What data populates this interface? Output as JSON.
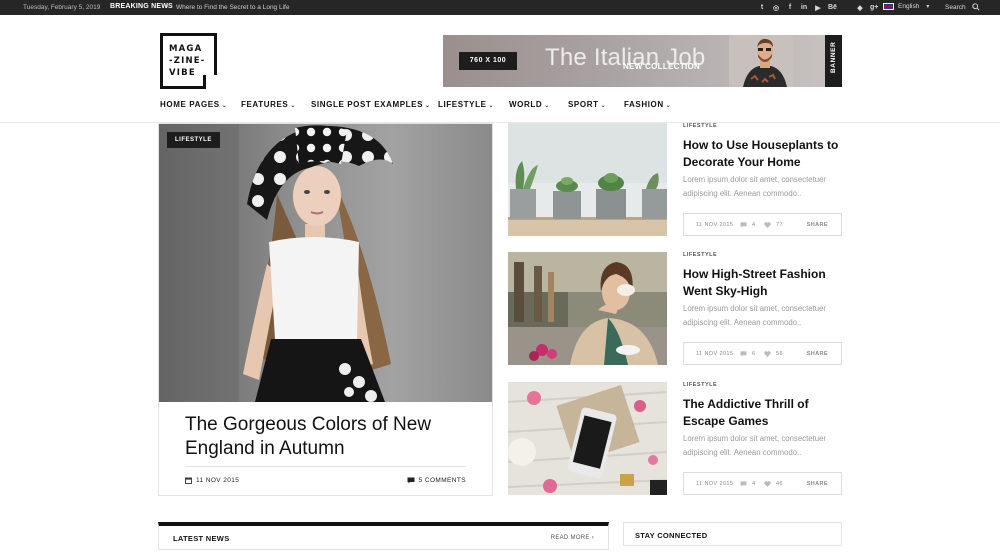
{
  "topbar": {
    "date": "Tuesday, February 5, 2019",
    "breaking_label": "BREAKING NEWS",
    "breaking_arrow": "›",
    "breaking_headline": "Where to Find the Secret to a Long Life",
    "social_icons": [
      "twitter-icon",
      "instagram-icon",
      "facebook-icon",
      "linkedin-icon",
      "youtube-icon",
      "behance-icon",
      "apple-icon",
      "android-icon",
      "google-plus-icon"
    ],
    "social_glyphs": [
      "t",
      "◎",
      "f",
      "in",
      "▶",
      "Bē",
      "",
      "◆",
      "g+"
    ],
    "language": "English",
    "search": "Search"
  },
  "logo": {
    "line1": "MAGA",
    "line2": "-ZINE-",
    "line3": "VIBE"
  },
  "banner": {
    "size": "760 X 100",
    "title": "The Italian Job",
    "subtitle": "NEW COLLECTION",
    "tag": "BANNER"
  },
  "nav": {
    "items": [
      {
        "label": "HOME PAGES"
      },
      {
        "label": "FEATURES"
      },
      {
        "label": "SINGLE POST EXAMPLES"
      },
      {
        "label": "LIFESTYLE"
      },
      {
        "label": "WORLD"
      },
      {
        "label": "SPORT"
      },
      {
        "label": "FASHION"
      }
    ]
  },
  "feature": {
    "category": "LIFESTYLE",
    "title": "The Gorgeous Colors of New England in Autumn",
    "date": "11 NOV 2015",
    "comments": "5 COMMENTS"
  },
  "articles": [
    {
      "category": "LIFESTYLE",
      "title": "How to Use Houseplants to Decorate Your Home",
      "excerpt": "Lorem ipsum dolor sit amet, consectetuer adipiscing elit. Aenean commodo..",
      "date": "11 NOV 2015",
      "comments": "4",
      "likes": "77",
      "share": "SHARE"
    },
    {
      "category": "LIFESTYLE",
      "title": "How High-Street Fashion Went Sky-High",
      "excerpt": "Lorem ipsum dolor sit amet, consectetuer adipiscing elit. Aenean commodo..",
      "date": "11 NOV 2015",
      "comments": "6",
      "likes": "56",
      "share": "SHARE"
    },
    {
      "category": "LIFESTYLE",
      "title": "The Addictive Thrill of Escape Games",
      "excerpt": "Lorem ipsum dolor sit amet, consectetuer adipiscing elit. Aenean commodo..",
      "date": "11 NOV 2015",
      "comments": "4",
      "likes": "46",
      "share": "SHARE"
    }
  ],
  "latest": {
    "title": "LATEST NEWS",
    "read_more": "READ MORE ›"
  },
  "stay": {
    "title": "STAY CONNECTED"
  }
}
